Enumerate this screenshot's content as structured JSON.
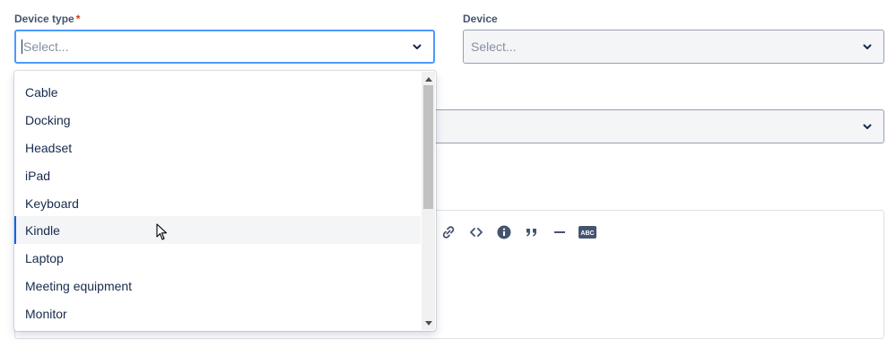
{
  "fields": {
    "device_type": {
      "label": "Device type",
      "required_mark": "*",
      "placeholder": "Select..."
    },
    "device": {
      "label": "Device",
      "placeholder": "Select..."
    }
  },
  "dropdown": {
    "options": [
      "Cable",
      "Docking",
      "Headset",
      "iPad",
      "Keyboard",
      "Kindle",
      "Laptop",
      "Meeting equipment",
      "Monitor"
    ],
    "highlighted": "Kindle"
  },
  "editor_toolbar": {
    "icons": [
      "link-icon",
      "code-icon",
      "info-icon",
      "quote-icon",
      "divider-icon",
      "spellcheck-icon"
    ],
    "spellcheck_text": "ABC"
  },
  "colors": {
    "focus_border": "#4c9aff",
    "highlight_bar": "#0c66e4",
    "required": "#de350b"
  }
}
